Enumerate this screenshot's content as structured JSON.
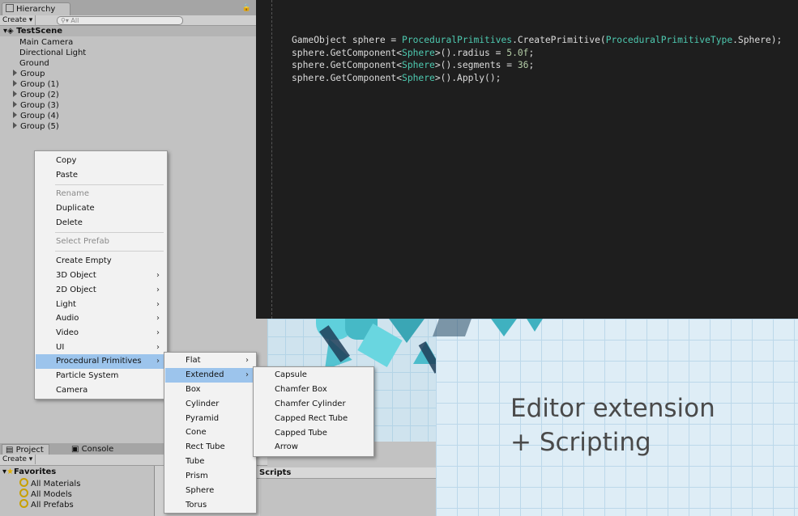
{
  "hierarchy": {
    "tab_title": "Hierarchy",
    "create_label": "Create",
    "search_placeholder": "All",
    "scene_name": "TestScene",
    "items": [
      "Main Camera",
      "Directional Light",
      "Ground"
    ],
    "groups": [
      "Group",
      "Group (1)",
      "Group (2)",
      "Group (3)",
      "Group (4)",
      "Group (5)"
    ]
  },
  "context_menu": {
    "items": [
      "Copy",
      "Paste",
      "Rename",
      "Duplicate",
      "Delete",
      "Select Prefab",
      "Create Empty",
      "3D Object",
      "2D Object",
      "Light",
      "Audio",
      "Video",
      "UI",
      "Procedural Primitives",
      "Particle System",
      "Camera"
    ],
    "highlighted": "Procedural Primitives"
  },
  "submenu_primitives": {
    "items": [
      "Flat",
      "Extended",
      "Box",
      "Cylinder",
      "Pyramid",
      "Cone",
      "Rect Tube",
      "Tube",
      "Prism",
      "Sphere",
      "Torus"
    ],
    "highlighted": "Extended"
  },
  "submenu_extended": {
    "items": [
      "Capsule",
      "Chamfer Box",
      "Chamfer Cylinder",
      "Capped Rect Tube",
      "Capped Tube",
      "Arrow"
    ]
  },
  "code": {
    "line1": {
      "a": "GameObject sphere = ",
      "b": "ProceduralPrimitives",
      "c": ".CreatePrimitive(",
      "d": "ProceduralPrimitiveType",
      "e": ".Sphere);"
    },
    "line2": {
      "a": "sphere.GetComponent<",
      "b": "Sphere",
      "c": ">().radius = ",
      "d": "5.0f",
      "e": ";"
    },
    "line3": {
      "a": "sphere.GetComponent<",
      "b": "Sphere",
      "c": ">().segments = ",
      "d": "36",
      "e": ";"
    },
    "line4": {
      "a": "sphere.GetComponent<",
      "b": "Sphere",
      "c": ">().Apply();"
    }
  },
  "project": {
    "tab_project": "Project",
    "tab_console": "Console",
    "create_label": "Create",
    "favorites_label": "Favorites",
    "favorites": [
      "All Materials",
      "All Models",
      "All Prefabs"
    ],
    "scripts_label": "Scripts"
  },
  "caption": {
    "line1": "Editor extension",
    "line2": "+ Scripting"
  },
  "colors": {
    "menu_highlight": "#9cc4ec",
    "code_background": "#1e1e1e",
    "code_type": "#4ec9b0",
    "code_number": "#b5cea8"
  }
}
